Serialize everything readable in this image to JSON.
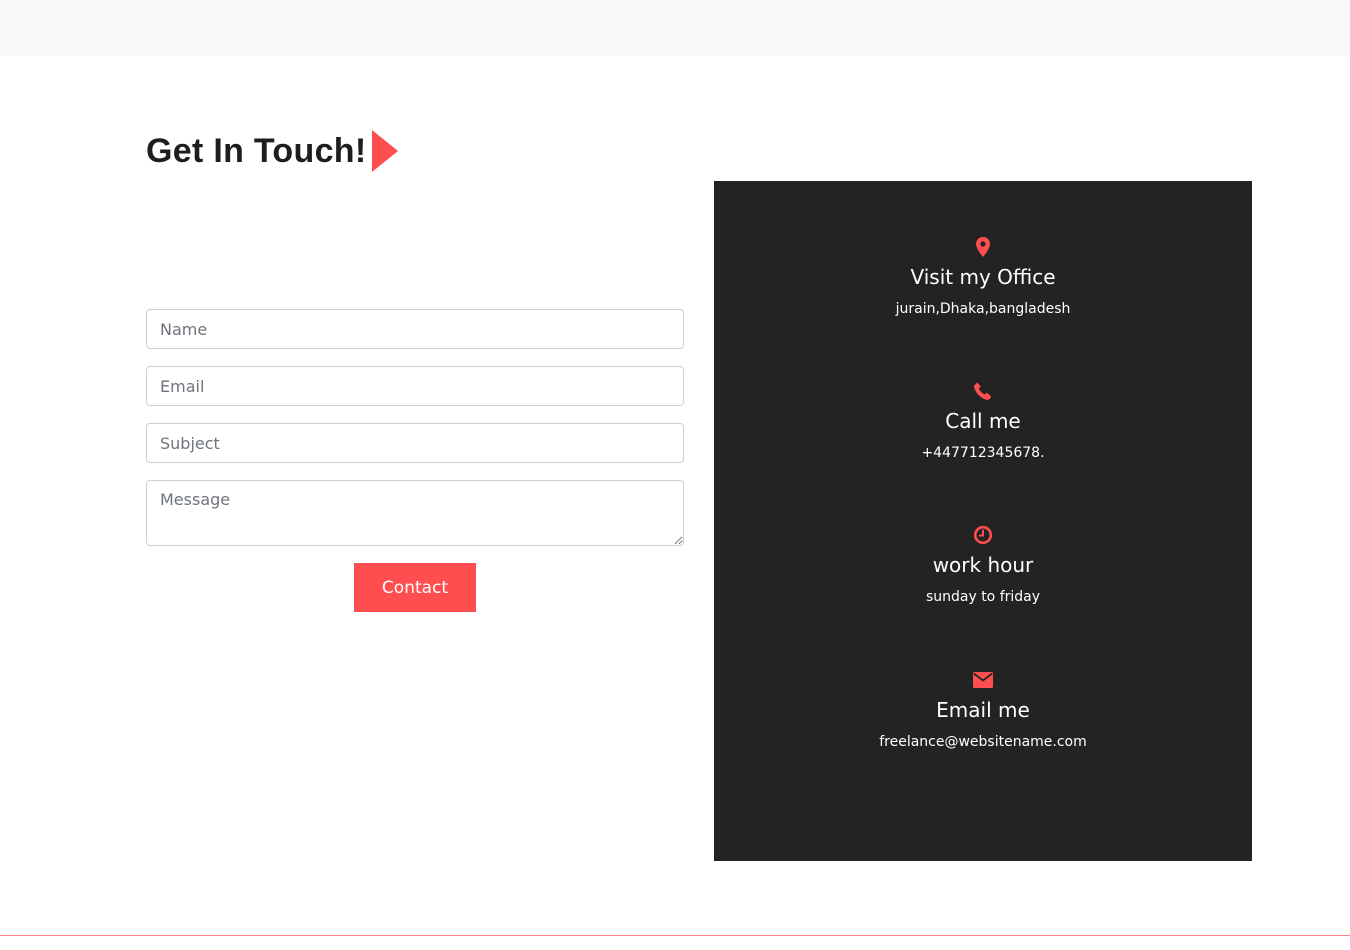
{
  "heading": {
    "title": "Get In Touch!"
  },
  "form": {
    "name_placeholder": "Name",
    "email_placeholder": "Email",
    "subject_placeholder": "Subject",
    "message_placeholder": "Message",
    "submit_label": "Contact"
  },
  "info": {
    "items": [
      {
        "icon": "map-marker-icon",
        "title": "Visit my Office",
        "text": "jurain,Dhaka,bangladesh"
      },
      {
        "icon": "phone-icon",
        "title": "Call me",
        "text": "+447712345678."
      },
      {
        "icon": "clock-icon",
        "title": "work hour",
        "text": "sunday to friday"
      },
      {
        "icon": "envelope-icon",
        "title": "Email me",
        "text": "freelance@websitename.com"
      }
    ]
  },
  "colors": {
    "accent": "#ff4e50",
    "panel_bg": "#232323",
    "topbar_bg": "#f8f8f8"
  }
}
